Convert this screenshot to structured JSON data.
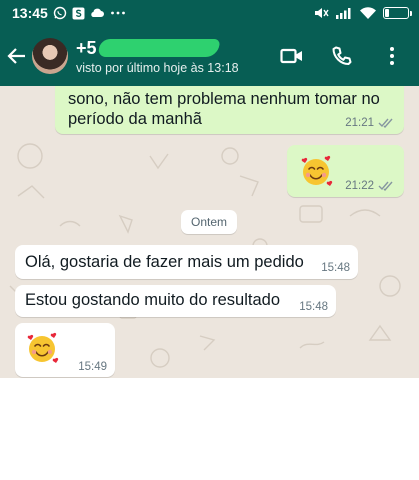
{
  "status_bar": {
    "time": "13:45",
    "battery": "17",
    "icons": [
      "whatsapp-icon",
      "s-app-icon",
      "cloud-icon",
      "more-dots-icon",
      "mute-icon",
      "signal-icon",
      "wifi-icon",
      "battery-icon"
    ],
    "battery_level": 0.17
  },
  "header": {
    "contact_name": "+5",
    "last_seen": "visto por último hoje às 13:18",
    "background": "#075e54",
    "actions": [
      "video-call-icon",
      "voice-call-icon",
      "more-vert-icon"
    ]
  },
  "messages": [
    {
      "direction": "out",
      "line1": "sono, não tem problema nenhum tomar no",
      "line2": "período da manhã",
      "time": "21:21",
      "status": "read"
    },
    {
      "direction": "out",
      "emoji": "smiling-face-with-hearts",
      "time": "21:22",
      "status": "read"
    },
    {
      "direction": "in",
      "text": "Olá, gostaria de fazer mais um pedido",
      "time": "15:48"
    },
    {
      "direction": "in",
      "text": "Estou gostando muito do resultado",
      "time": "15:48"
    },
    {
      "direction": "in",
      "emoji": "smiling-face-with-hearts",
      "time": "15:49"
    }
  ],
  "date_divider": "Ontem",
  "colors": {
    "outgoing_bubble": "#dcf8c6",
    "incoming_bubble": "#ffffff",
    "chat_background": "#ece5dd",
    "read_ticks": "#8696a0"
  }
}
